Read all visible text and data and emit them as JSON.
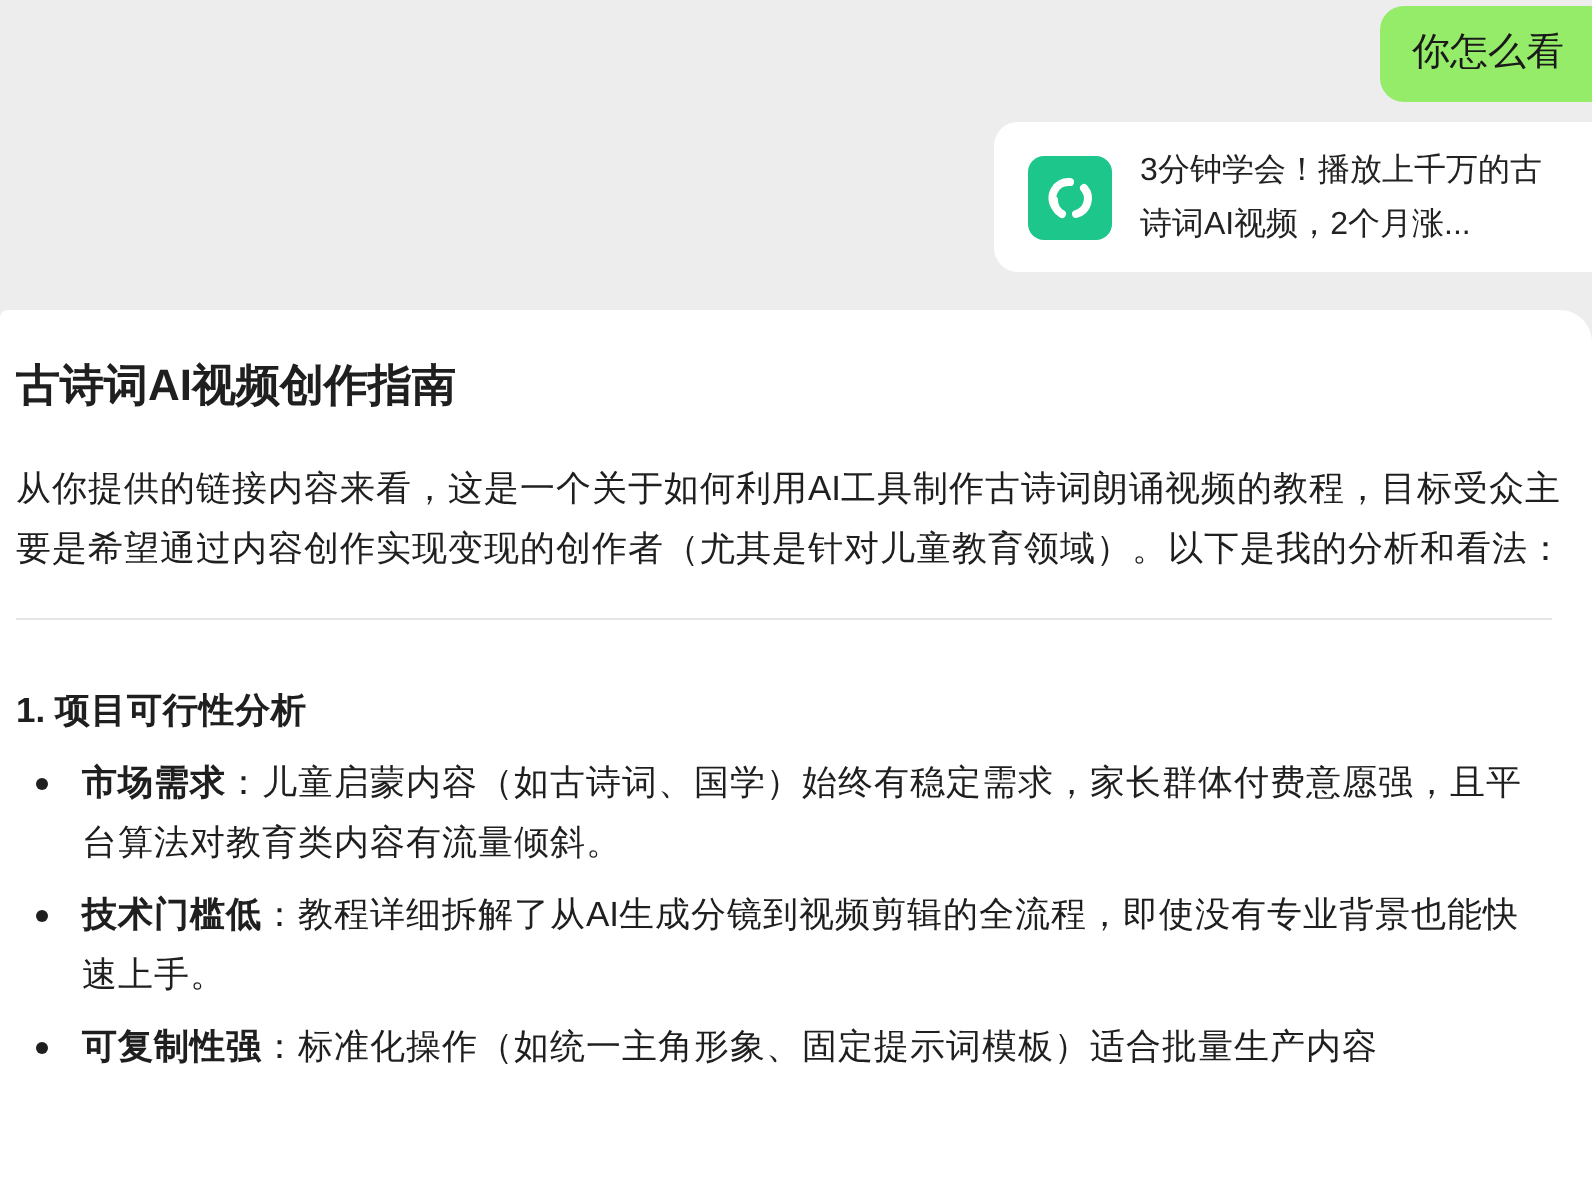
{
  "user_message": {
    "text": "你怎么看"
  },
  "shared_link": {
    "title": "3分钟学会！播放上千万的古诗词AI视频，2个月涨..."
  },
  "answer": {
    "title": "古诗词AI视频创作指南",
    "intro": "从你提供的链接内容来看，这是一个关于如何利用AI工具制作古诗词朗诵视频的教程，目标受众主要是希望通过内容创作实现变现的创作者（尤其是针对儿童教育领域）。以下是我的分析和看法：",
    "section_heading": "1. 项目可行性分析",
    "bullets": [
      {
        "term": "市场需求",
        "text": "：儿童启蒙内容（如古诗词、国学）始终有稳定需求，家长群体付费意愿强，且平台算法对教育类内容有流量倾斜。"
      },
      {
        "term": "技术门槛低",
        "text": "：教程详细拆解了从AI生成分镜到视频剪辑的全流程，即使没有专业背景也能快速上手。"
      },
      {
        "term": "可复制性强",
        "text": "：标准化操作（如统一主角形象、固定提示词模板）适合批量生产内容"
      }
    ]
  }
}
